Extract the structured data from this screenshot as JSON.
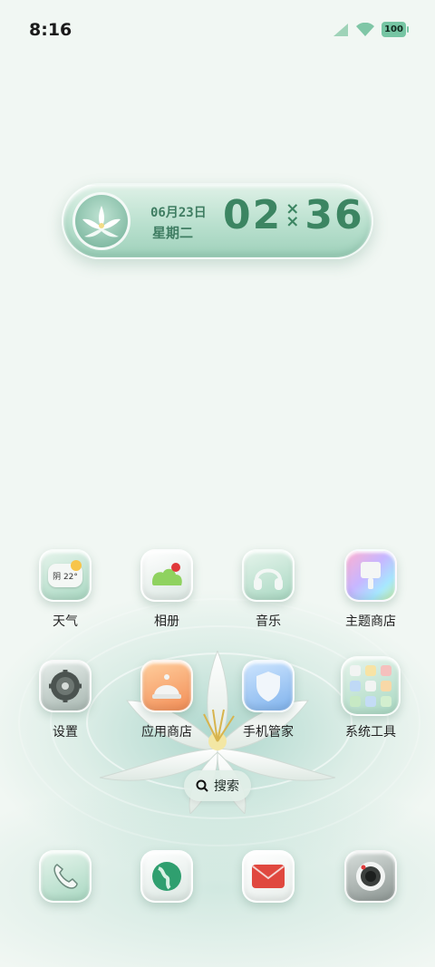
{
  "status_bar": {
    "time": "8:16",
    "battery": "100"
  },
  "clock_widget": {
    "date": "06月23日",
    "weekday": "星期二",
    "hour": "02",
    "minute": "36"
  },
  "apps": [
    {
      "id": "weather",
      "label": "天气",
      "icon": "weather-icon",
      "weather_text": "阴 22°"
    },
    {
      "id": "photos",
      "label": "相册",
      "icon": "photos-icon"
    },
    {
      "id": "music",
      "label": "音乐",
      "icon": "headphones-icon"
    },
    {
      "id": "themes",
      "label": "主题商店",
      "icon": "paint-brush-icon"
    },
    {
      "id": "settings",
      "label": "设置",
      "icon": "gear-icon"
    },
    {
      "id": "appstore",
      "label": "应用商店",
      "icon": "app-store-icon"
    },
    {
      "id": "phone-manager",
      "label": "手机管家",
      "icon": "shield-icon"
    },
    {
      "id": "system-tools",
      "label": "系统工具",
      "icon": "folder-icon"
    }
  ],
  "search": {
    "label": "搜索"
  },
  "dock": [
    {
      "id": "phone",
      "icon": "phone-icon"
    },
    {
      "id": "browser",
      "icon": "globe-icon"
    },
    {
      "id": "messages",
      "icon": "envelope-icon"
    },
    {
      "id": "camera",
      "icon": "camera-icon"
    }
  ],
  "colors": {
    "accent": "#3c8562",
    "background": "#f1f7f3"
  }
}
